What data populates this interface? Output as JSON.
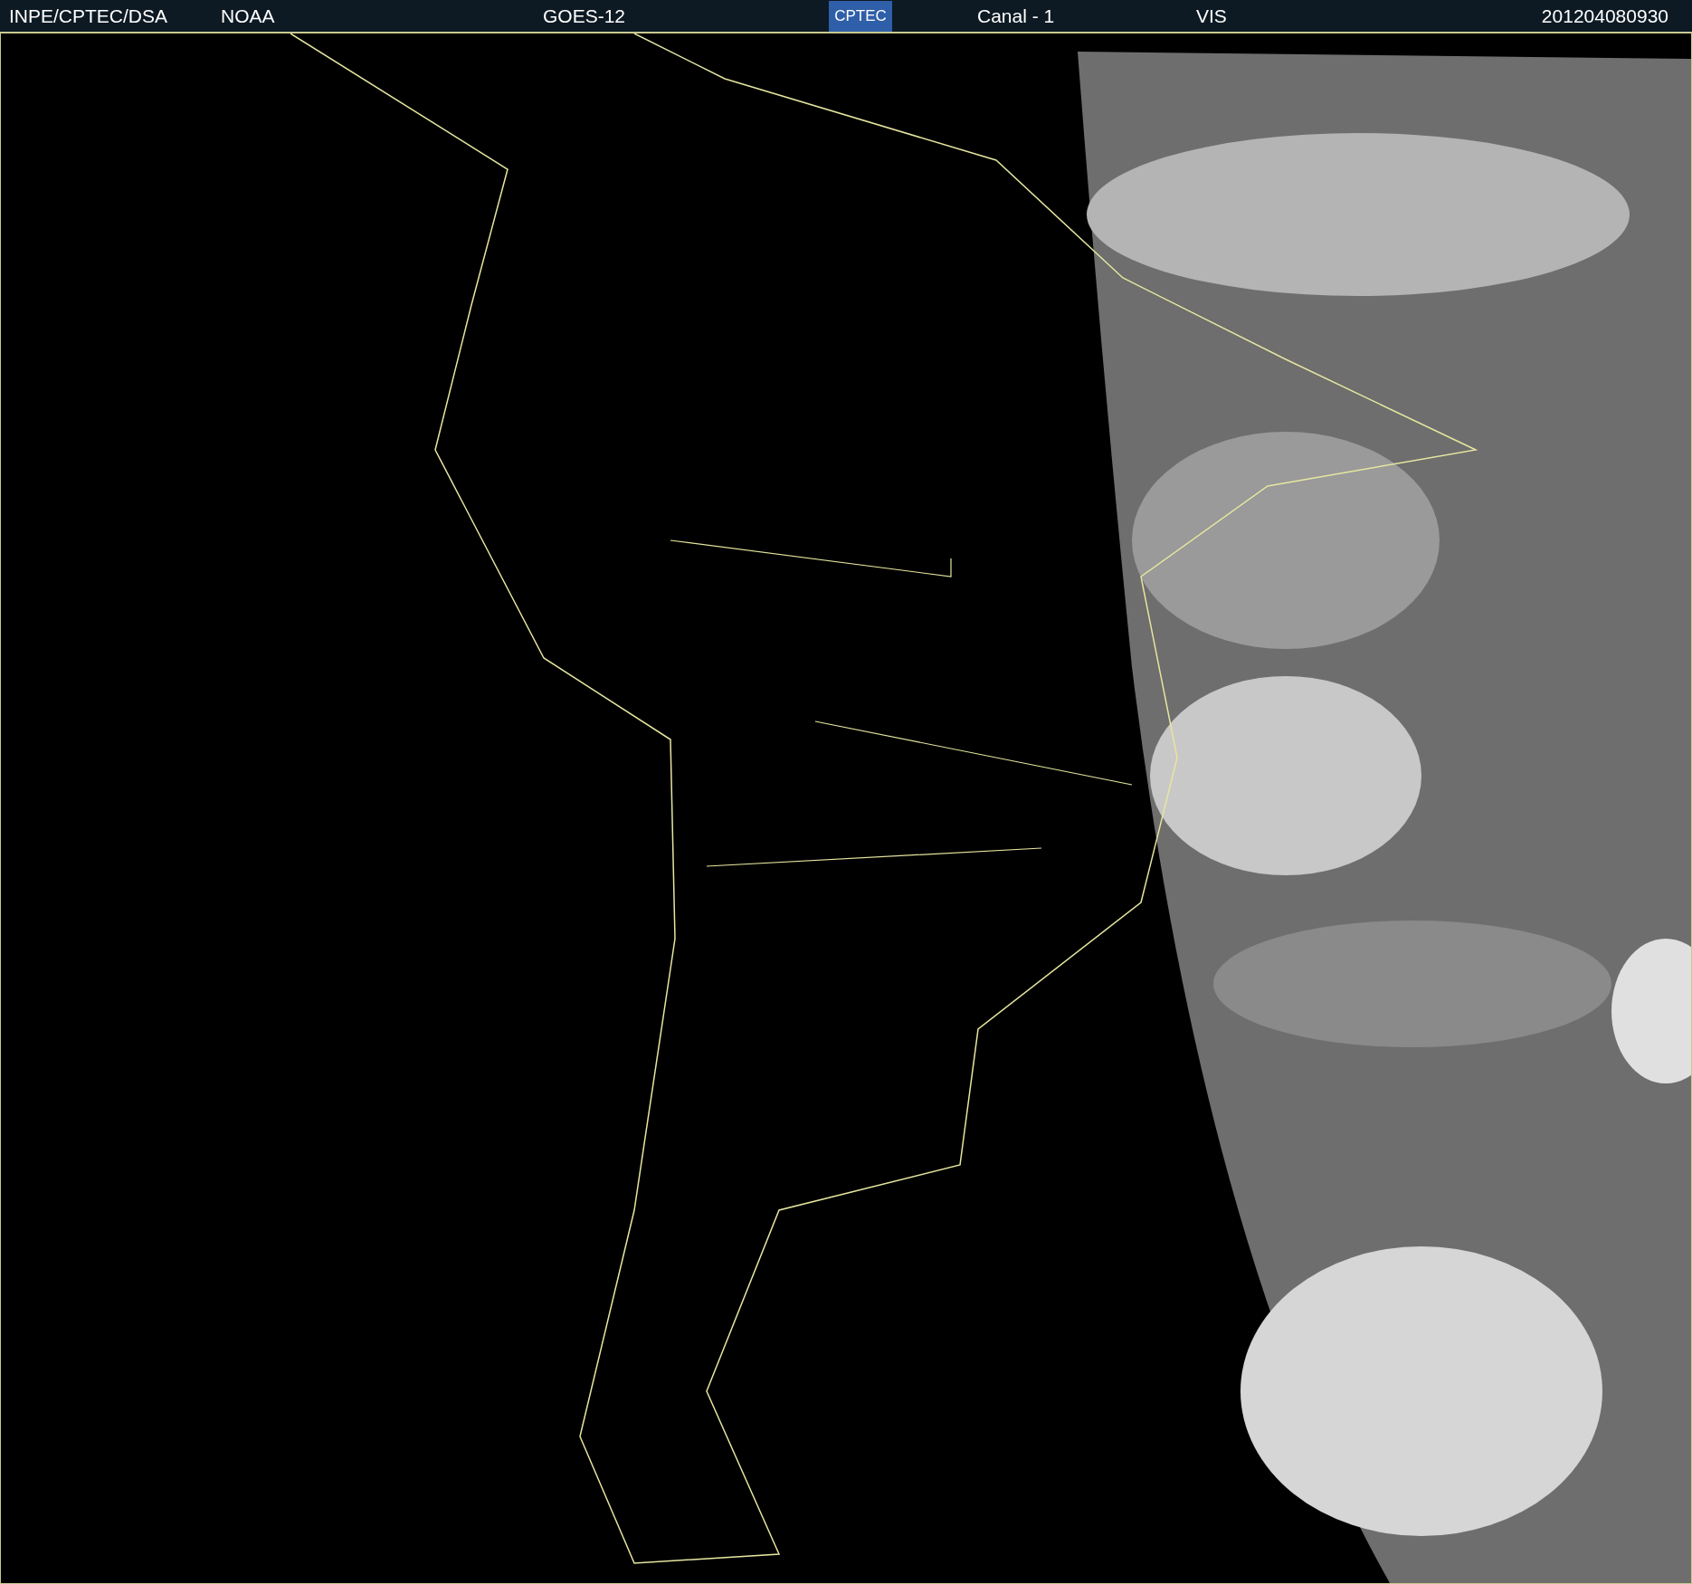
{
  "header": {
    "agency": "INPE/CPTEC/DSA",
    "source": "NOAA",
    "satellite": "GOES-12",
    "logo": "CPTEC",
    "channel": "Canal - 1",
    "band": "VIS",
    "timestamp": "201204080930"
  }
}
